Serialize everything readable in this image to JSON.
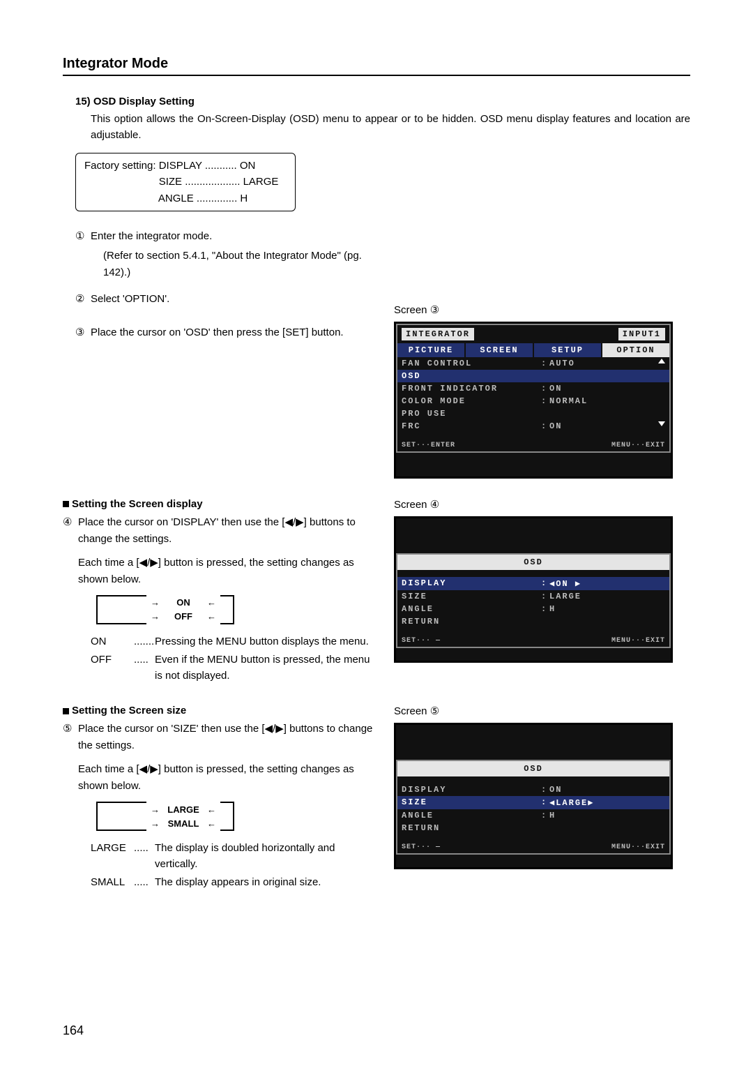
{
  "page_number": "164",
  "section_title": "Integrator Mode",
  "heading": "15) OSD Display Setting",
  "intro": "This option allows the On-Screen-Display (OSD) menu to appear or to be hidden. OSD menu display features and location are adjustable.",
  "factory": {
    "lead": "Factory setting:",
    "lines": [
      {
        "k": "DISPLAY",
        "dots": " ...........",
        "v": " ON"
      },
      {
        "k": "SIZE",
        "dots": " ...................",
        "v": " LARGE"
      },
      {
        "k": "ANGLE",
        "dots": " ..............",
        "v": " H"
      }
    ]
  },
  "steps": {
    "s1_num": "①",
    "s1": "Enter the integrator mode.",
    "s1_ref": "(Refer to section 5.4.1, \"About the Integrator Mode\" (pg. 142).)",
    "s2_num": "②",
    "s2": "Select 'OPTION'.",
    "s3_num": "③",
    "s3": "Place the cursor on 'OSD' then press the [SET] button."
  },
  "screen3_label": "Screen ③",
  "osd3": {
    "title_left": "INTEGRATOR",
    "title_right": "INPUT1",
    "tabs": [
      "PICTURE",
      "SCREEN",
      "SETUP",
      "OPTION"
    ],
    "rows": [
      {
        "k": "FAN CONTROL",
        "v": "AUTO",
        "arrow": "up"
      },
      {
        "k": "OSD",
        "v": "",
        "sel": true
      },
      {
        "k": "FRONT INDICATOR",
        "v": "ON"
      },
      {
        "k": "COLOR MODE",
        "v": "NORMAL"
      },
      {
        "k": "PRO USE",
        "v": ""
      },
      {
        "k": "FRC",
        "v": "ON",
        "arrow": "down"
      }
    ],
    "foot_left": "SET···ENTER",
    "foot_right": "MENU···EXIT"
  },
  "block_display": {
    "title": "Setting the Screen display",
    "s4_num": "④",
    "s4_a": "Place the cursor on 'DISPLAY' then use the [◀/▶] buttons to change the settings.",
    "s4_b": "Each time a [◀/▶] button is pressed, the setting changes as shown below.",
    "opt1": "ON",
    "opt2": "OFF",
    "desc": [
      {
        "t": "ON",
        "dots": ".......",
        "d": "Pressing the MENU button displays the menu."
      },
      {
        "t": "OFF",
        "dots": ".....",
        "d": "Even if the MENU button is pressed, the menu is not displayed."
      }
    ]
  },
  "screen4_label": "Screen ④",
  "osd4": {
    "title": "OSD",
    "rows": [
      {
        "k": "DISPLAY",
        "v": "◀ON ▶",
        "sel": true
      },
      {
        "k": "SIZE",
        "v": "LARGE"
      },
      {
        "k": "ANGLE",
        "v": "H"
      },
      {
        "k": " RETURN",
        "v": ""
      }
    ],
    "foot_left": "SET··· —",
    "foot_right": "MENU···EXIT"
  },
  "block_size": {
    "title": "Setting the Screen size",
    "s5_num": "⑤",
    "s5_a": "Place the cursor on 'SIZE' then use the [◀/▶] buttons to change the settings.",
    "s5_b": "Each time a [◀/▶] button is pressed, the setting changes as shown below.",
    "opt1": "LARGE",
    "opt2": "SMALL",
    "desc": [
      {
        "t": "LARGE",
        "dots": ".....",
        "d": "The display is doubled horizontally and vertically."
      },
      {
        "t": "SMALL",
        "dots": ".....",
        "d": "The display appears in original size."
      }
    ]
  },
  "screen5_label": "Screen ⑤",
  "osd5": {
    "title": "OSD",
    "rows": [
      {
        "k": "DISPLAY",
        "v": "ON"
      },
      {
        "k": "SIZE",
        "v": "◀LARGE▶",
        "sel": true
      },
      {
        "k": "ANGLE",
        "v": "H"
      },
      {
        "k": " RETURN",
        "v": ""
      }
    ],
    "foot_left": "SET··· —",
    "foot_right": "MENU···EXIT"
  }
}
